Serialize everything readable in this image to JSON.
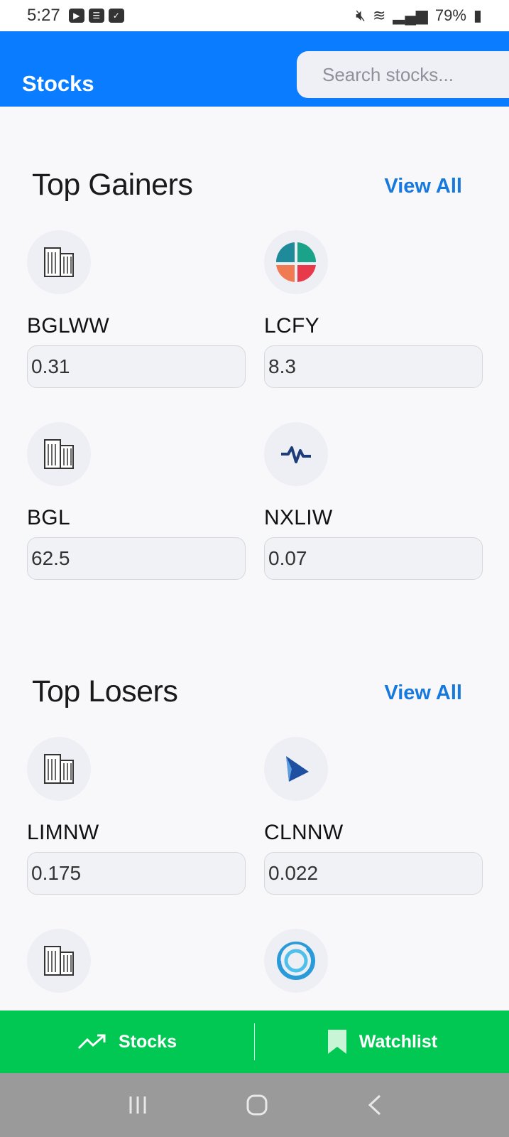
{
  "status_bar": {
    "time": "5:27",
    "battery": "79%"
  },
  "app": {
    "title": "Stocks",
    "search_placeholder": "Search stocks..."
  },
  "top_gainers": {
    "title": "Top Gainers",
    "view_all": "View All",
    "items": [
      {
        "symbol": "BGLWW",
        "price": "0.31",
        "logo": "building-icon"
      },
      {
        "symbol": "LCFY",
        "price": "8.3",
        "logo": "pie-logo-icon"
      },
      {
        "symbol": "BGL",
        "price": "62.5",
        "logo": "building-icon"
      },
      {
        "symbol": "NXLIW",
        "price": "0.07",
        "logo": "pulse-logo-icon"
      }
    ]
  },
  "top_losers": {
    "title": "Top Losers",
    "view_all": "View All",
    "items": [
      {
        "symbol": "LIMNW",
        "price": "0.175",
        "logo": "building-icon"
      },
      {
        "symbol": "CLNNW",
        "price": "0.022",
        "logo": "sail-logo-icon"
      },
      {
        "symbol": "",
        "price": "",
        "logo": "building-icon"
      },
      {
        "symbol": "",
        "price": "",
        "logo": "swirl-logo-icon"
      }
    ]
  },
  "bottom_nav": {
    "stocks_label": "Stocks",
    "watchlist_label": "Watchlist"
  },
  "colors": {
    "primary": "#0a7cff",
    "nav_green": "#00c853",
    "link_blue": "#1779de"
  }
}
